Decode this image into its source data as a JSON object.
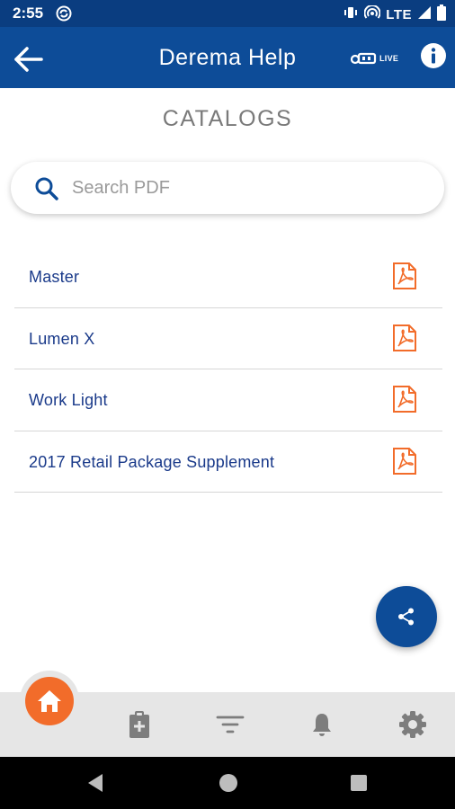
{
  "status_bar": {
    "time": "2:55",
    "network": "LTE",
    "icons": [
      "sync-icon",
      "vibrate-icon",
      "hotspot-icon",
      "signal-icon",
      "battery-icon"
    ]
  },
  "app_bar": {
    "title": "Derema Help",
    "live_label": "LIVE",
    "icons": [
      "back-arrow-icon",
      "live-chat-icon",
      "info-icon"
    ]
  },
  "page": {
    "heading": "CATALOGS"
  },
  "search": {
    "placeholder": "Search PDF",
    "value": ""
  },
  "catalogs": [
    {
      "label": "Master",
      "icon": "pdf-icon"
    },
    {
      "label": "Lumen X",
      "icon": "pdf-icon"
    },
    {
      "label": "Work Light",
      "icon": "pdf-icon"
    },
    {
      "label": "2017 Retail Package Supplement",
      "icon": "pdf-icon"
    }
  ],
  "fab": {
    "icon": "share-icon"
  },
  "bottom_nav": {
    "items": [
      {
        "icon": "home-icon",
        "active": true
      },
      {
        "icon": "clipboard-plus-icon",
        "active": false
      },
      {
        "icon": "filter-icon",
        "active": false
      },
      {
        "icon": "bell-icon",
        "active": false
      },
      {
        "icon": "gear-icon",
        "active": false
      }
    ]
  },
  "system_nav": {
    "icons": [
      "back-triangle-icon",
      "home-circle-icon",
      "recents-square-icon"
    ]
  },
  "colors": {
    "primary": "#0d4c98",
    "status_bar": "#0a3d80",
    "accent": "#f26c2a",
    "list_text": "#1a3a8a",
    "heading_text": "#7a7a7a",
    "nav_background": "#e6e6e6",
    "nav_icon": "#7d7d7d"
  }
}
